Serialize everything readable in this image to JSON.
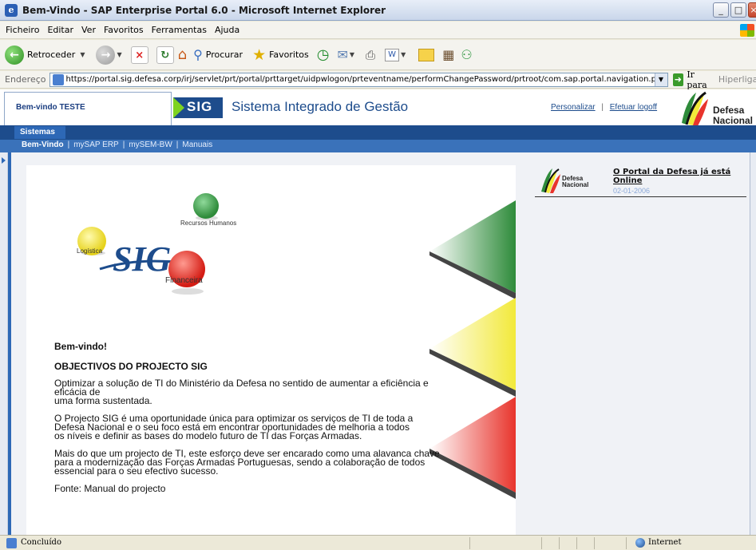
{
  "window": {
    "title": "Bem-Vindo - SAP Enterprise Portal 6.0 - Microsoft Internet Explorer",
    "min_glyph": "_",
    "max_glyph": "□",
    "close_glyph": "×"
  },
  "menu": {
    "items": [
      "Ficheiro",
      "Editar",
      "Ver",
      "Favoritos",
      "Ferramentas",
      "Ajuda"
    ]
  },
  "toolbar": {
    "back_label": "Retroceder",
    "search_label": "Procurar",
    "favorites_label": "Favoritos",
    "word_glyph": "W"
  },
  "address": {
    "label": "Endereço",
    "url": "https://portal.sig.defesa.corp/irj/servlet/prt/portal/prttarget/uidpwlogon/prteventname/performChangePassword/prtroot/com.sap.portal.navigation.portallaur",
    "go_label": "Ir para",
    "links_label": "Hiperligações"
  },
  "portal": {
    "welcome_user": "Bem-vindo TESTE",
    "logo_text": "SIG",
    "system_title": "Sistema Integrado de Gestão",
    "personalize": "Personalizar",
    "link_sep": "|",
    "logoff": "Efetuar logoff",
    "brand_line1": "Defesa",
    "brand_line2": "Nacional",
    "top_tab": "Sistemas",
    "nav": [
      "Bem-Vindo",
      "mySAP ERP",
      "mySEM-BW",
      "Manuais"
    ],
    "nav_sep": "|"
  },
  "graphic": {
    "logo_word": "SIG",
    "labels": {
      "hr": "Recursos Humanos",
      "logistics": "Logística",
      "finance": "Financeira"
    },
    "colors": {
      "green": "#2e8b3a",
      "yellow": "#f2e93a",
      "red": "#e8342c",
      "navy": "#1d4c8c"
    }
  },
  "content": {
    "greeting": "Bem-vindo!",
    "heading": "OBJECTIVOS DO PROJECTO SIG",
    "p1_l1": "Optimizar a solução de TI do Ministério da Defesa no sentido de aumentar a eficiência e eficácia de",
    "p1_l2": "uma forma sustentada.",
    "p2_l1": "O Projecto SIG é uma oportunidade única para optimizar os serviços de TI de toda a",
    "p2_l2": "Defesa Nacional e o seu foco está em encontrar oportunidades de melhoria a todos",
    "p2_l3": "os níveis e definir as bases do modelo futuro de TI das Forças Armadas.",
    "p3_l1": "Mais do que um projecto de TI, este esforço deve ser encarado como uma alavanca chave",
    "p3_l2": "para a modernização das Forças Armadas Portuguesas, sendo a colaboração de todos",
    "p3_l3": "essencial para o seu efectivo sucesso.",
    "source": "Fonte: Manual do projecto"
  },
  "news": {
    "title": "O Portal da Defesa já está Online",
    "date": "02-01-2006",
    "logo_l1": "Defesa",
    "logo_l2": "Nacional"
  },
  "status": {
    "text": "Concluído",
    "zone": "Internet"
  }
}
